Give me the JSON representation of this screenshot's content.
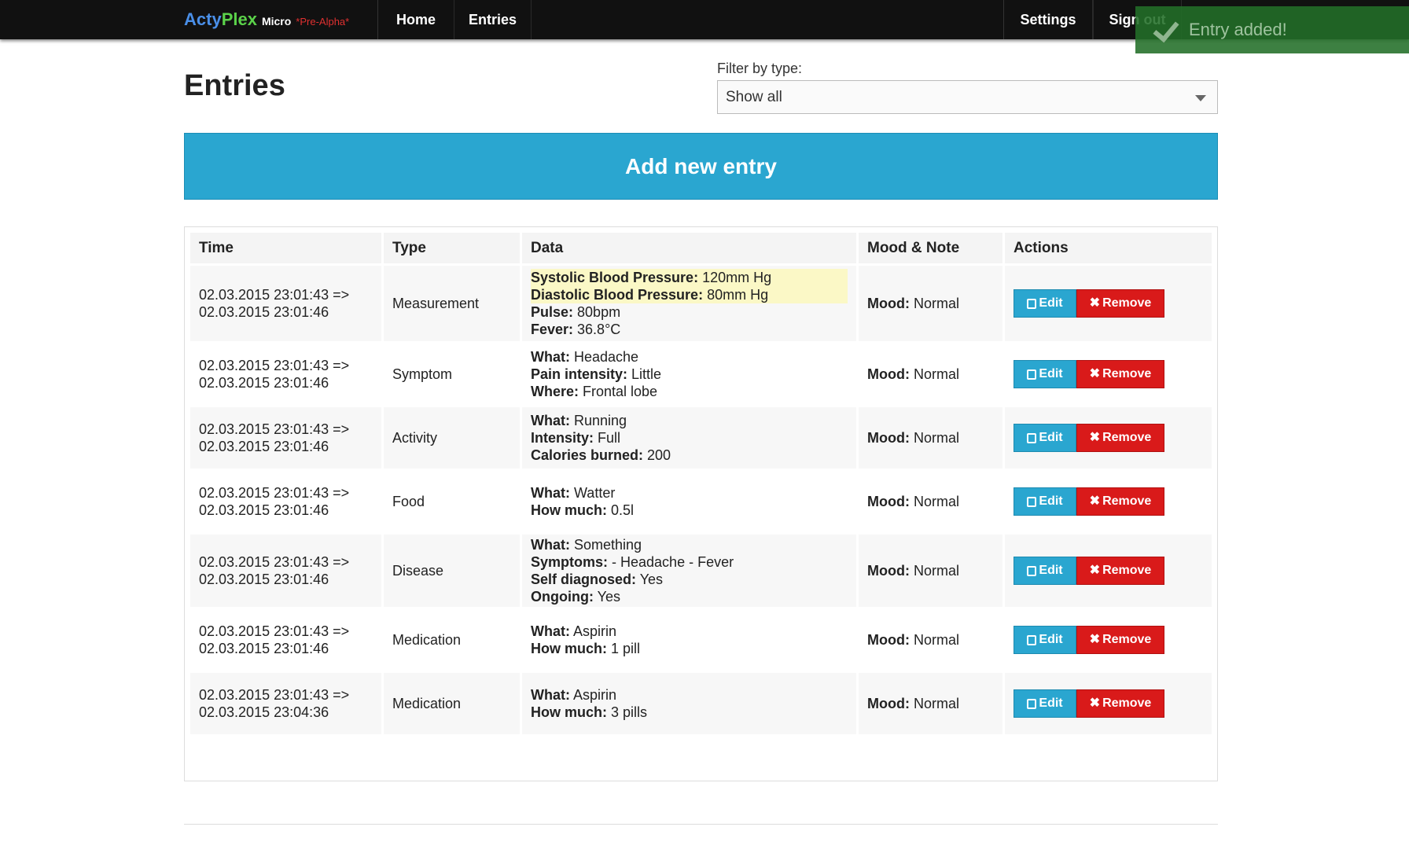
{
  "brand": {
    "part1": "Acty",
    "part2": "Plex",
    "part3": "Micro",
    "tag": "*Pre-Alpha*"
  },
  "nav": {
    "home": "Home",
    "entries": "Entries",
    "settings": "Settings",
    "signout": "Sign out"
  },
  "toast": {
    "text": "Entry added!"
  },
  "page": {
    "title": "Entries",
    "filter_label": "Filter by type:",
    "filter_value": "Show all",
    "add_button": "Add new entry"
  },
  "table": {
    "headers": [
      "Time",
      "Type",
      "Data",
      "Mood & Note",
      "Actions"
    ],
    "edit_label": "Edit",
    "remove_label": "Remove",
    "rows": [
      {
        "time1": "02.03.2015 23:01:43 =>",
        "time2": "02.03.2015 23:01:46",
        "type": "Measurement",
        "data": [
          [
            "Systolic Blood Pressure:",
            " 120mm Hg"
          ],
          [
            "Diastolic Blood Pressure:",
            " 80mm Hg"
          ],
          [
            "Pulse:",
            " 80bpm"
          ],
          [
            "Fever:",
            " 36.8°C"
          ]
        ],
        "mood_label": "Mood:",
        "mood": " Normal"
      },
      {
        "time1": "02.03.2015 23:01:43 =>",
        "time2": "02.03.2015 23:01:46",
        "type": "Symptom",
        "data": [
          [
            "What:",
            " Headache"
          ],
          [
            "Pain intensity:",
            " Little"
          ],
          [
            "Where:",
            " Frontal lobe"
          ]
        ],
        "mood_label": "Mood:",
        "mood": " Normal"
      },
      {
        "time1": "02.03.2015 23:01:43 =>",
        "time2": "02.03.2015 23:01:46",
        "type": "Activity",
        "data": [
          [
            "What:",
            " Running"
          ],
          [
            "Intensity:",
            " Full"
          ],
          [
            "Calories burned:",
            " 200"
          ]
        ],
        "mood_label": "Mood:",
        "mood": " Normal"
      },
      {
        "time1": "02.03.2015 23:01:43 =>",
        "time2": "02.03.2015 23:01:46",
        "type": "Food",
        "data": [
          [
            "What:",
            " Watter"
          ],
          [
            "How much:",
            " 0.5l"
          ]
        ],
        "mood_label": "Mood:",
        "mood": " Normal"
      },
      {
        "time1": "02.03.2015 23:01:43 =>",
        "time2": "02.03.2015 23:01:46",
        "type": "Disease",
        "data": [
          [
            "What:",
            " Something"
          ],
          [
            "Symptoms:",
            " - Headache - Fever"
          ],
          [
            "Self diagnosed:",
            " Yes"
          ],
          [
            "Ongoing:",
            " Yes"
          ]
        ],
        "mood_label": "Mood:",
        "mood": " Normal"
      },
      {
        "time1": "02.03.2015 23:01:43 =>",
        "time2": "02.03.2015 23:01:46",
        "type": "Medication",
        "data": [
          [
            "What:",
            " Aspirin"
          ],
          [
            "How much:",
            " 1 pill"
          ]
        ],
        "mood_label": "Mood:",
        "mood": " Normal"
      },
      {
        "time1": "02.03.2015 23:01:43 =>",
        "time2": "02.03.2015 23:04:36",
        "type": "Medication",
        "data": [
          [
            "What:",
            " Aspirin"
          ],
          [
            "How much:",
            " 3 pills"
          ]
        ],
        "mood_label": "Mood:",
        "mood": " Normal"
      }
    ]
  },
  "colors": {
    "navbar": "#111111",
    "accent_blue": "#2aa6d0",
    "remove_red": "#d91a1a",
    "highlight": "#fbf8c6",
    "toast_green": "#226e28"
  },
  "icons": {
    "edit": "edit-icon",
    "remove": "x-icon",
    "toast": "check-icon",
    "select": "chevron-down-icon"
  }
}
